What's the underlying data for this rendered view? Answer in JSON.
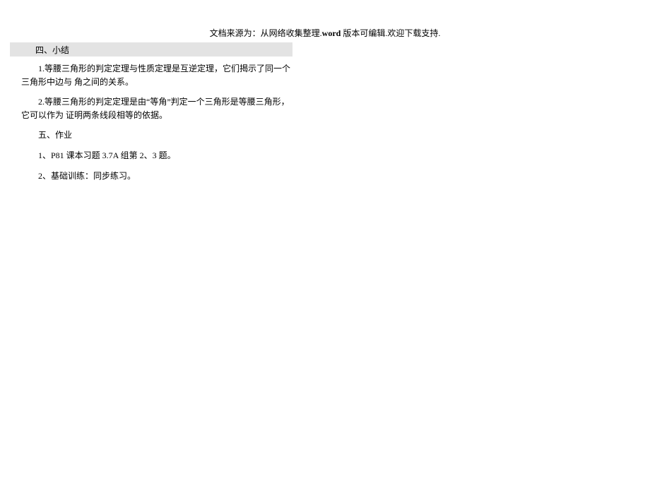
{
  "header": {
    "prefix": "文档来源为：从网络收集整理.",
    "bold": "word",
    "suffix": " 版本可编辑.欢迎下载支持."
  },
  "section_heading": "四、小结",
  "paragraphs": {
    "p1": "1.等腰三角形的判定定理与性质定理是互逆定理，它们揭示了同一个三角形中边与 角之间的关系。",
    "p2": "2.等腰三角形的判定定理是由“等角”判定一个三角形是等腰三角形，它可以作为 证明两条线段相等的依据。",
    "p3": "五、作业",
    "p4": "1、P81 课本习题 3.7A 组第 2、3 题。",
    "p5": "2、基础训练：同步练习。"
  }
}
